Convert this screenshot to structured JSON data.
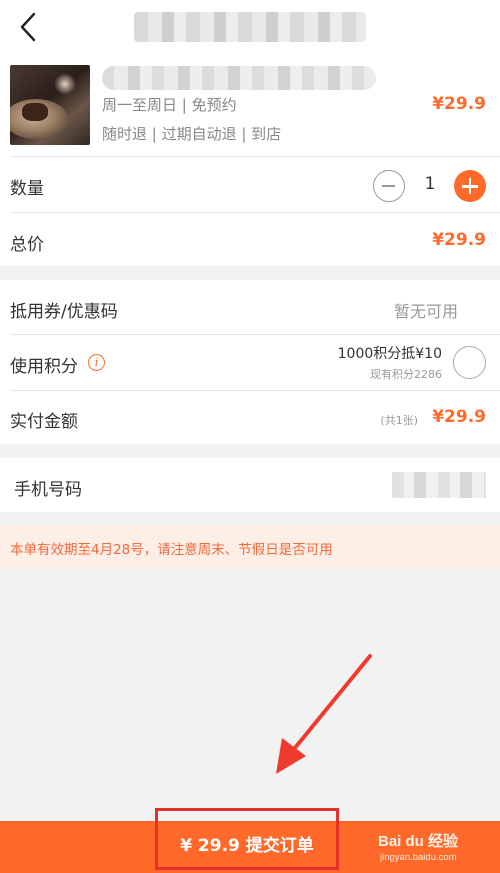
{
  "product": {
    "validity": "周一至周日 | 免预约",
    "refund": "随时退 | 过期自动退 | 到店",
    "price": "¥29.9"
  },
  "quantity": {
    "label": "数量",
    "value": "1"
  },
  "total": {
    "label": "总价",
    "value": "¥29.9"
  },
  "coupon": {
    "label": "抵用券/优惠码",
    "value": "暂无可用"
  },
  "points": {
    "label": "使用积分",
    "info_icon": "i",
    "offer": "1000积分抵¥10",
    "balance": "现有积分2286"
  },
  "payment": {
    "label": "实付金额",
    "count": "(共1张)",
    "value": "¥29.9"
  },
  "phone": {
    "label": "手机号码"
  },
  "notice": "本单有效期至4月28号，请注意周末、节假日是否可用",
  "footer": {
    "submit": "¥ 29.9 提交订单"
  },
  "watermark": {
    "logo": "Bai du 经验",
    "url": "jingyan.baidu.com"
  },
  "colors": {
    "accent": "#ff6a2a",
    "highlight_box": "#e8302a",
    "notice_bg": "#fdeee6"
  },
  "icons": [
    "back-arrow-icon",
    "minus-icon",
    "plus-icon",
    "info-icon",
    "radio-unchecked-icon",
    "annotation-arrow"
  ]
}
